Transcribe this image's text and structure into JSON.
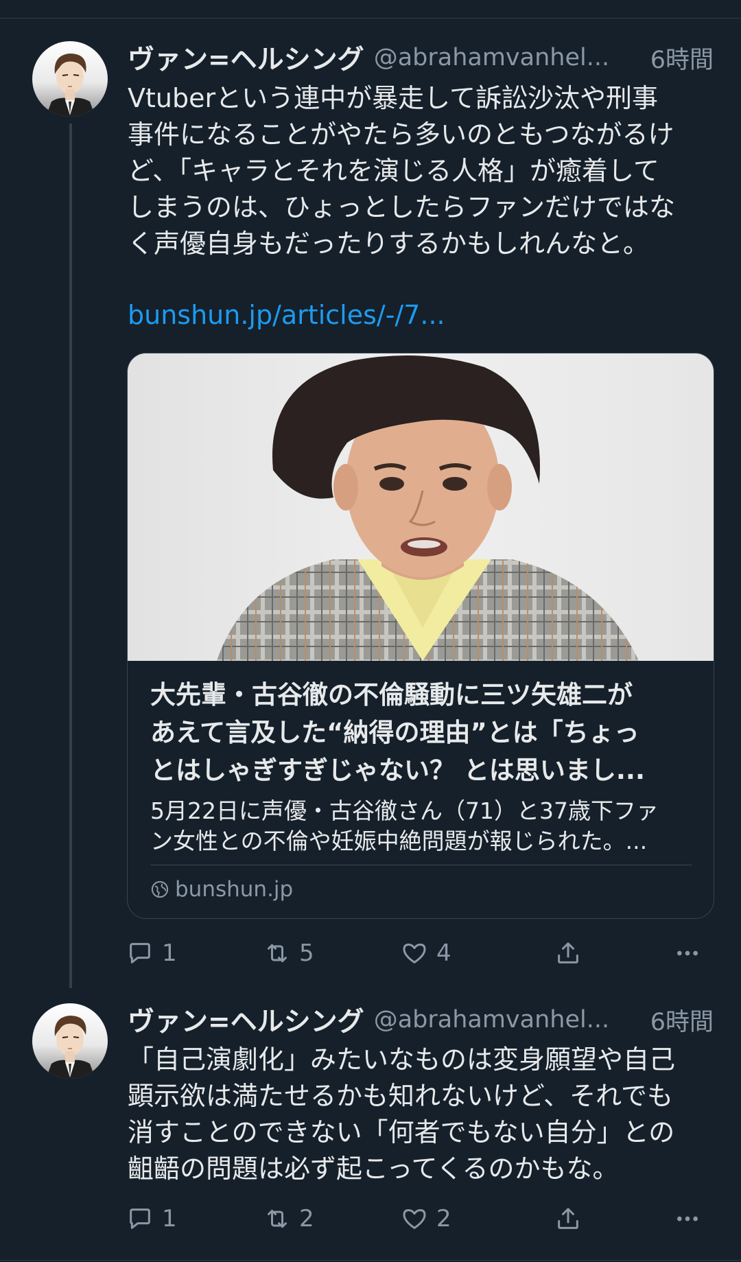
{
  "tweets": [
    {
      "name": "ヴァン=ヘルシング",
      "handle": "@abrahamvanhel...",
      "time": "6時間",
      "text_lines": [
        "Vtuberという連中が暴走して訴訟沙汰や刑事",
        "事件になることがやたら多いのともつながるけ",
        "ど、「キャラとそれを演じる人格」が癒着して",
        "しまうのは、ひょっとしたらファンだけではな",
        "く声優自身もだったりするかもしれんなと。"
      ],
      "link": "bunshun.jp/articles/-/7...",
      "card": {
        "title_lines": [
          "大先輩・古谷徹の不倫騒動に三ツ矢雄二が",
          "あえて言及した“納得の理由”とは「ちょっ",
          "とはしゃぎすぎじゃない？ とは思いまし..."
        ],
        "desc_lines": [
          "5月22日に声優・古谷徹さん（71）と37歳下ファ",
          "ン女性との不倫や妊娠中絶問題が報じられた。..."
        ],
        "domain": "bunshun.jp"
      },
      "stats": {
        "replies": "1",
        "retweets": "5",
        "likes": "4"
      }
    },
    {
      "name": "ヴァン=ヘルシング",
      "handle": "@abrahamvanhel...",
      "time": "6時間",
      "text_lines": [
        "「自己演劇化」みたいなものは変身願望や自己",
        "顕示欲は満たせるかも知れないけど、それでも",
        "消すことのできない「何者でもない自分」との",
        "齟齬の問題は必ず起こってくるのかもな。"
      ],
      "stats": {
        "replies": "1",
        "retweets": "2",
        "likes": "2"
      }
    }
  ],
  "colors": {
    "background": "#15202b",
    "text": "#e7e9ea",
    "muted": "#8b98a5",
    "link": "#1d9bf0",
    "border": "#38444d"
  },
  "icons": [
    "reply-icon",
    "retweet-icon",
    "like-icon",
    "share-icon",
    "more-icon",
    "globe-icon"
  ]
}
